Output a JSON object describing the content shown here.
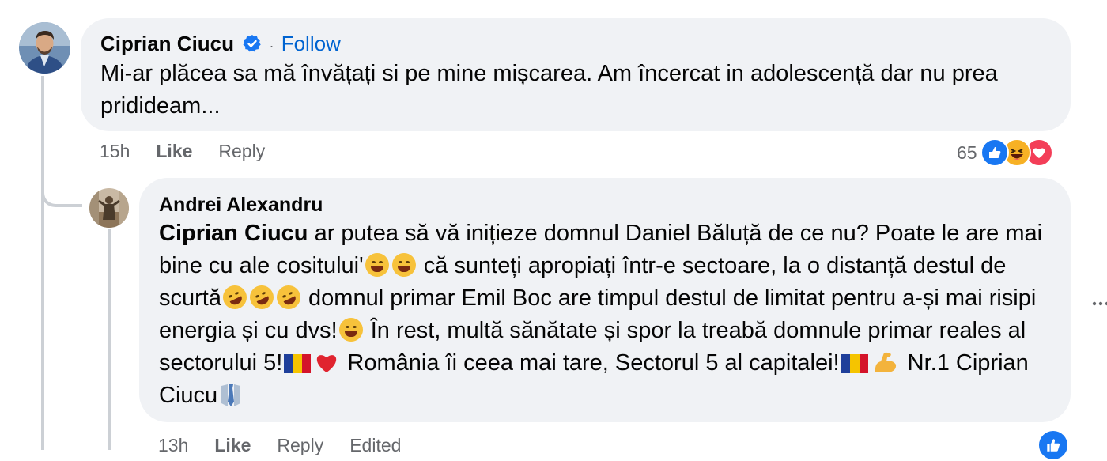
{
  "comment": {
    "author": "Ciprian Ciucu",
    "dot": "·",
    "follow_label": "Follow",
    "text": "Mi-ar plăcea sa mă învățați si pe mine mișcarea. Am încercat in adolescență dar nu prea pridideam...",
    "time": "15h",
    "like_label": "Like",
    "reply_label": "Reply",
    "reaction_count": "65",
    "reactions": [
      "like-icon",
      "laugh-icon",
      "love-icon"
    ],
    "verified_icon": "verified-badge-icon"
  },
  "reply": {
    "author": "Andrei Alexandru",
    "mention": "Ciprian Ciucu",
    "seg1": " ar putea să vă inițieze domnul Daniel Băluță de ce nu? Poate le are mai bine cu ale cositului'",
    "seg2": " că sunteți apropiați într-e sectoare, la o distanță destul de scurtă",
    "seg3": " domnul primar Emil Boc are timpul destul de limitat pentru a-și mai risipi energia și cu dvs!",
    "seg4": " În rest, multă sănătate și spor la treabă domnule primar reales al sectorului 5!",
    "seg5": " România îi ceea mai tare, Sectorul 5 al capitalei!",
    "seg6": " Nr.1 Ciprian Ciucu",
    "time": "13h",
    "like_label": "Like",
    "reply_label": "Reply",
    "edited_label": "Edited",
    "emojis": [
      "squinting-face-icon",
      "grinning-sweat-icon",
      "rofl-icon",
      "romania-flag-icon",
      "red-heart-icon",
      "flexed-biceps-icon",
      "necktie-icon"
    ]
  },
  "colors": {
    "bubble": "#f0f2f5",
    "link": "#0064d1",
    "secondary_text": "#65676b",
    "like_blue": "#1877f2",
    "love_red": "#f33e58",
    "thread_line": "#ccd0d5"
  },
  "more_icon": "more-options-icon"
}
